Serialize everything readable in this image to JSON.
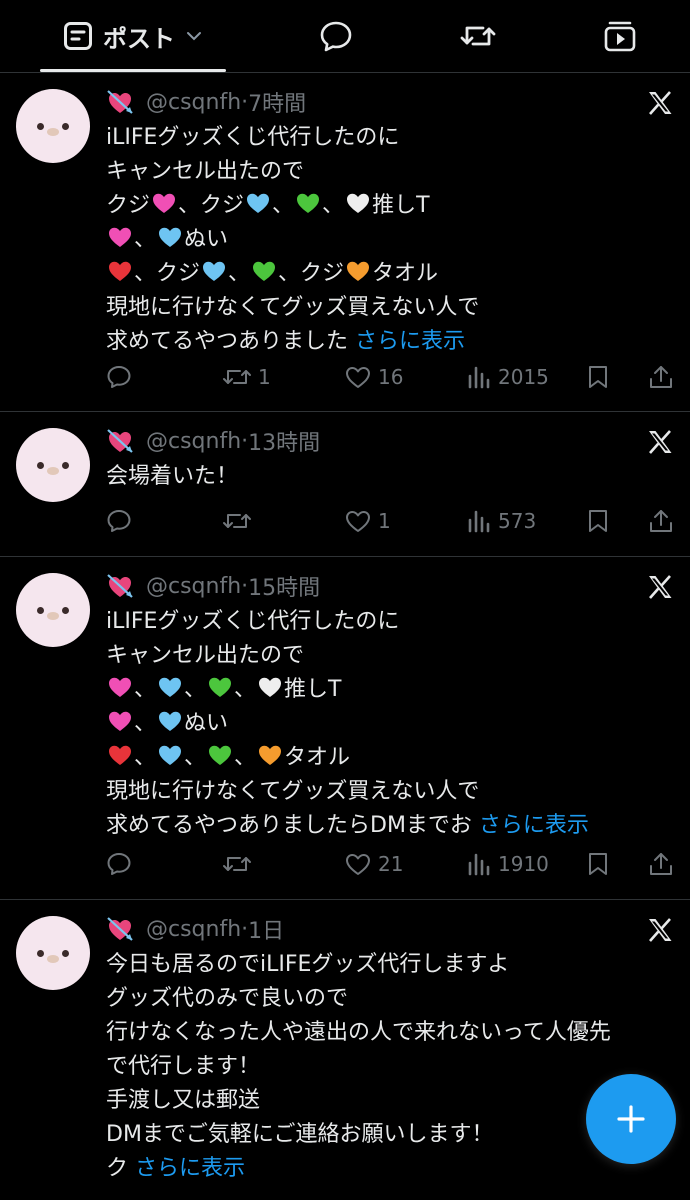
{
  "tabs": {
    "posts_label": "ポスト"
  },
  "colors": {
    "accent": "#1d9bf0",
    "background": "#000000",
    "muted": "#71767b",
    "text": "#e7e9ea"
  },
  "posts": [
    {
      "handle": "@csqnfh",
      "time": "7時間",
      "lines": [
        [
          "iLIFEグッズくじ代行したのに"
        ],
        [
          "キャンセル出たので"
        ],
        [
          "クジ",
          "{pink}",
          "、クジ",
          "{blue}",
          "、",
          "{green}",
          "、",
          "{white}",
          "推しT"
        ],
        [
          "{pink}",
          "、",
          "{blue}",
          "ぬい"
        ],
        [
          "{red}",
          "、クジ",
          "{blue}",
          "、",
          "{green}",
          "、クジ",
          "{orange}",
          "タオル"
        ],
        [
          "現地に行けなくてグッズ買えない人で"
        ],
        [
          "求めてるやつありました ",
          "{more}"
        ]
      ],
      "more_label": "さらに表示",
      "replies": "",
      "reposts": "1",
      "likes": "16",
      "views": "2015"
    },
    {
      "handle": "@csqnfh",
      "time": "13時間",
      "lines": [
        [
          "会場着いた！"
        ]
      ],
      "replies": "",
      "reposts": "",
      "likes": "1",
      "views": "573"
    },
    {
      "handle": "@csqnfh",
      "time": "15時間",
      "lines": [
        [
          "iLIFEグッズくじ代行したのに"
        ],
        [
          "キャンセル出たので"
        ],
        [
          "{pink}",
          "、",
          "{blue}",
          "、",
          "{green}",
          "、",
          "{white}",
          "推しT"
        ],
        [
          "{pink}",
          "、",
          "{blue}",
          "ぬい"
        ],
        [
          "{red}",
          "、",
          "{blue}",
          "、",
          "{green}",
          "、",
          "{orange}",
          "タオル"
        ],
        [
          "現地に行けなくてグッズ買えない人で"
        ],
        [
          "求めてるやつありましたらDMまでお ",
          "{more}"
        ]
      ],
      "more_label": "さらに表示",
      "replies": "",
      "reposts": "",
      "likes": "21",
      "views": "1910"
    },
    {
      "handle": "@csqnfh",
      "time": "1日",
      "lines": [
        [
          "今日も居るのでiLIFEグッズ代行しますよ"
        ],
        [
          "グッズ代のみで良いので"
        ],
        [
          "行けなくなった人や遠出の人で来れないって人優先"
        ],
        [
          "で代行します！"
        ],
        [
          "手渡し又は郵送"
        ],
        [
          "DMまでご気軽にご連絡お願いします！"
        ],
        [
          "ク ",
          "{more}"
        ]
      ],
      "more_label": "さらに表示",
      "replies": "",
      "reposts": "",
      "likes": "",
      "views": ""
    }
  ],
  "heart_colors": {
    "pink": "#f04fb5",
    "blue": "#6ec4f2",
    "green": "#4cc63d",
    "white": "#eeeeee",
    "red": "#e8343a",
    "orange": "#f59c2e",
    "arrow_heart": "#e8457c"
  },
  "icons": {
    "tab_posts": "list-icon",
    "tab_replies": "speech-bubble-icon",
    "tab_reposts": "repost-icon",
    "tab_media": "media-play-icon",
    "compose": "plus-icon"
  }
}
